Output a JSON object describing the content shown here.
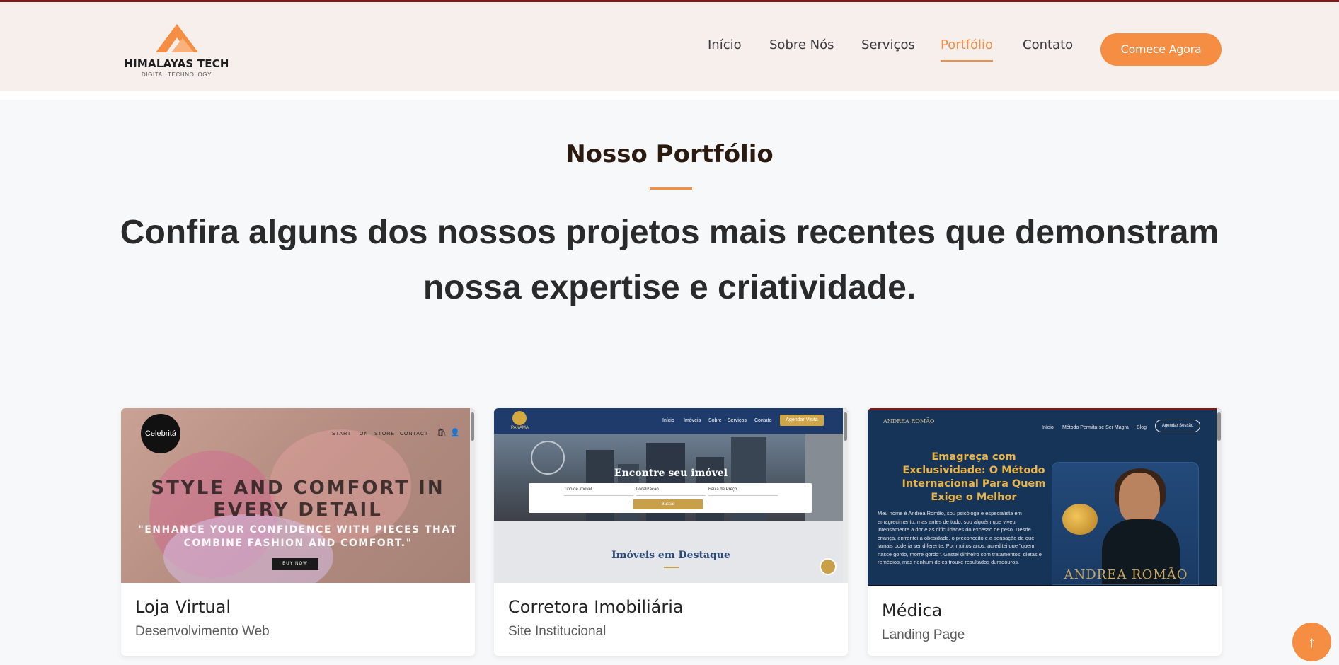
{
  "header": {
    "logo_name": "HIMALAYAS TECH",
    "logo_sub": "DIGITAL TECHNOLOGY",
    "nav": [
      {
        "label": "Início"
      },
      {
        "label": "Sobre Nós"
      },
      {
        "label": "Serviços"
      },
      {
        "label": "Portfólio",
        "active": true
      },
      {
        "label": "Contato"
      }
    ],
    "cta_label": "Comece Agora"
  },
  "colors": {
    "accent": "#f58d43",
    "header_bg": "#f6efec",
    "page_bg": "#f7f8fa"
  },
  "section": {
    "title": "Nosso Portfólio",
    "lead": "Confira alguns dos nossos projetos mais recentes que demonstram nossa expertise e criatividade."
  },
  "portfolio": [
    {
      "title": "Loja Virtual",
      "subtitle": "Desenvolvimento Web",
      "preview": {
        "logo": "Celebritá",
        "nav": [
          "START",
          "ON",
          "STORE",
          "CONTACT"
        ],
        "headline": "STYLE AND COMFORT IN EVERY DETAIL",
        "quote": "\"ENHANCE YOUR CONFIDENCE WITH PIECES THAT COMBINE FASHION AND COMFORT.\"",
        "button": "BUY NOW"
      }
    },
    {
      "title": "Corretora Imobiliária",
      "subtitle": "Site Institucional",
      "preview": {
        "logo": "PANAMA",
        "nav": [
          "Início",
          "Imóveis",
          "Sobre",
          "Serviços",
          "Contato"
        ],
        "button": "Agendar Visita",
        "hero": "Encontre seu imóvel",
        "fields": [
          "Tipo de Imóvel",
          "Localização",
          "Faixa de Preço"
        ],
        "search": "Buscar",
        "featured": "Imóveis em Destaque"
      }
    },
    {
      "title": "Médica",
      "subtitle": "Landing Page",
      "preview": {
        "logo": "ANDREA ROMÃO",
        "nav": [
          "Início",
          "Método Permita-se Ser Magra",
          "Blog"
        ],
        "button": "Agendar Sessão",
        "headline": "Emagreça com Exclusividade: O Método Internacional Para Quem Exige o Melhor",
        "paragraph": "Meu nome é Andrea Romão, sou psicóloga e especialista em emagrecimento, mas antes de tudo, sou alguém que viveu intensamente a dor e as dificuldades do excesso de peso. Desde criança, enfrentei a obesidade, o preconceito e a sensação de que jamais poderia ser diferente. Por muitos anos, acreditei que \"quem nasce gordo, morre gordo\". Gastei dinheiro com tratamentos, dietas e remédios, mas nenhum deles trouxe resultados duradouros.",
        "name_banner": "ANDREA ROMÃO"
      }
    }
  ],
  "back_to_top": "↑"
}
